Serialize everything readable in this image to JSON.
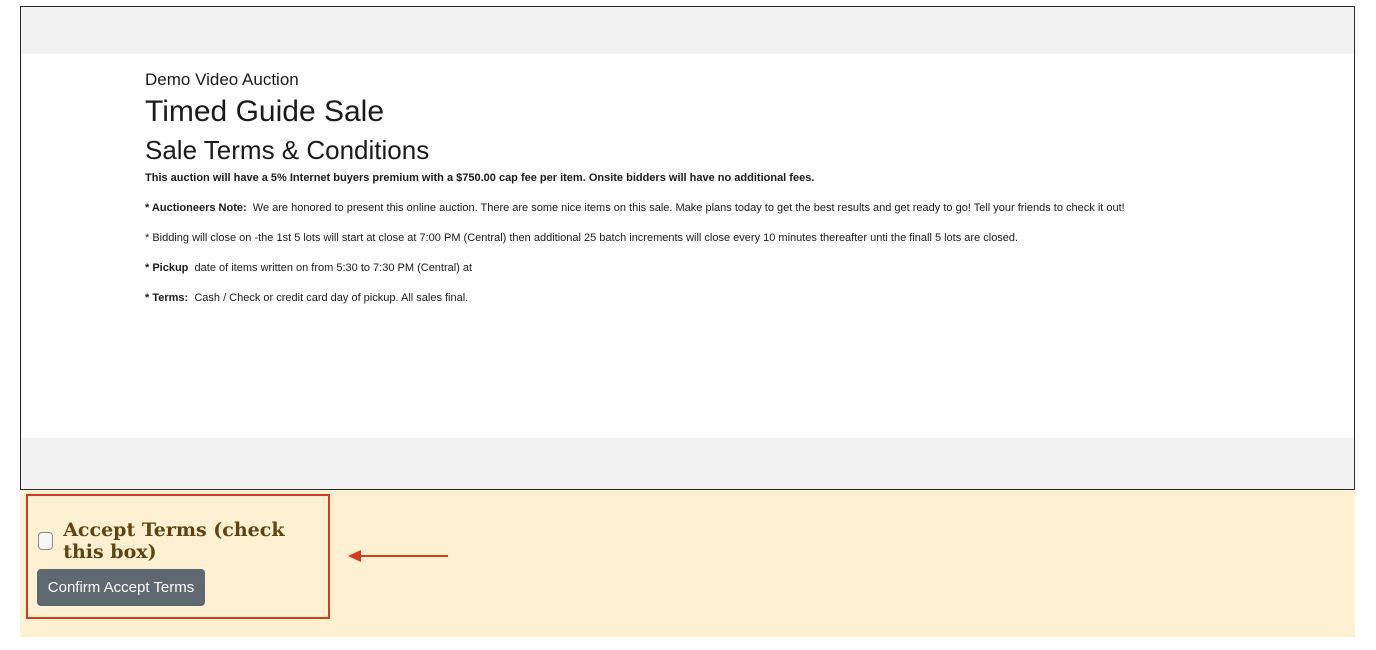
{
  "terms": {
    "auction_name": "Demo Video Auction",
    "sale_title": "Timed Guide Sale",
    "heading": "Sale Terms & Conditions",
    "premium_note": "This auction will have a 5% Internet buyers premium with a $750.00 cap fee per item. Onsite bidders will have no additional fees.",
    "items": [
      {
        "label": "* Auctioneers Note:",
        "text": "We are honored to present this online auction. There are some nice items on this sale. Make plans today to get the best results and get ready to go! Tell your friends to check it out!"
      },
      {
        "label": "",
        "text": "* Bidding will close on -the 1st  5 lots will start at close at 7:00 PM (Central) then additional 25 batch increments will close every 10 minutes thereafter unti the finall 5 lots are closed."
      },
      {
        "label": "* Pickup",
        "text": "date of items written on  from 5:30 to 7:30 PM (Central) at"
      },
      {
        "label": "* Terms:",
        "text": "Cash / Check or credit card day of pickup. All sales final."
      }
    ]
  },
  "accept": {
    "checkbox_label": "Accept Terms (check this box)",
    "confirm_button": "Confirm Accept Terms",
    "checked": false
  },
  "colors": {
    "panel_background": "#fdf1d1",
    "highlight_border": "#d23c1f",
    "button_background": "#5f6870",
    "label_color": "#5e4414"
  },
  "icons": {
    "annotation_arrow": "arrow-left-icon"
  }
}
